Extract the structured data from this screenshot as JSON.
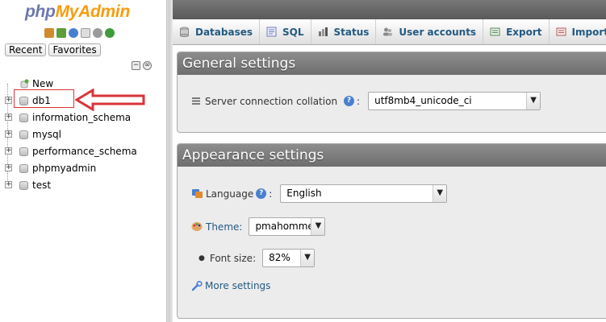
{
  "logo": {
    "part1": "php",
    "part2": "MyAdmin"
  },
  "nav": {
    "recent_label": "Recent",
    "favorites_label": "Favorites",
    "databases": [
      {
        "name": "New",
        "icon": "new-db-icon"
      },
      {
        "name": "db1",
        "icon": "database-icon"
      },
      {
        "name": "information_schema",
        "icon": "database-icon"
      },
      {
        "name": "mysql",
        "icon": "database-icon"
      },
      {
        "name": "performance_schema",
        "icon": "database-icon"
      },
      {
        "name": "phpmyadmin",
        "icon": "database-icon"
      },
      {
        "name": "test",
        "icon": "database-icon"
      }
    ]
  },
  "tabs": [
    {
      "label": "Databases",
      "icon": "database-icon"
    },
    {
      "label": "SQL",
      "icon": "sql-icon"
    },
    {
      "label": "Status",
      "icon": "status-icon"
    },
    {
      "label": "User accounts",
      "icon": "users-icon"
    },
    {
      "label": "Export",
      "icon": "export-icon"
    },
    {
      "label": "Import",
      "icon": "import-icon"
    }
  ],
  "general": {
    "title": "General settings",
    "collation_label": "Server connection collation",
    "collation_value": "utf8mb4_unicode_ci"
  },
  "appearance": {
    "title": "Appearance settings",
    "language_label": "Language",
    "language_value": "English",
    "theme_label": "Theme:",
    "theme_value": "pmahomme",
    "fontsize_label": "Font size:",
    "fontsize_value": "82%",
    "more_settings": "More settings"
  },
  "colors": {
    "accent": "#235a81",
    "highlight": "#d9343a",
    "logo_blue": "#6c78af",
    "logo_orange": "#f89c0e"
  }
}
